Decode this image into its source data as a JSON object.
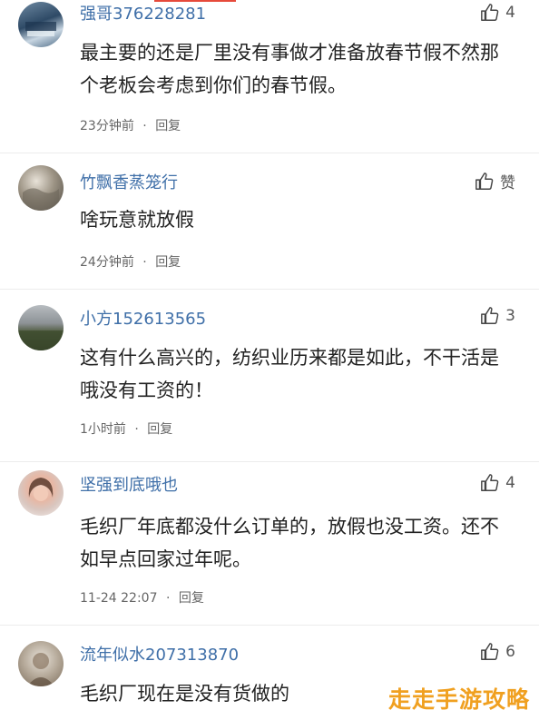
{
  "comments": [
    {
      "username": "强哥376228281",
      "likes": "4",
      "content": "最主要的还是厂里没有事做才准备放春节假不然那个老板会考虑到你们的春节假。",
      "time": "23分钟前",
      "reply": "回复"
    },
    {
      "username": "竹飘香蒸笼行",
      "likes": "赞",
      "content": "啥玩意就放假",
      "time": "24分钟前",
      "reply": "回复"
    },
    {
      "username": "小方152613565",
      "likes": "3",
      "content": "这有什么高兴的，纺织业历来都是如此，不干活是哦没有工资的！",
      "time": "1小时前",
      "reply": "回复"
    },
    {
      "username": "坚强到底哦也",
      "likes": "4",
      "content": "毛织厂年底都没什么订单的，放假也没工资。还不如早点回家过年呢。",
      "time": "11-24 22:07",
      "reply": "回复"
    },
    {
      "username": "流年似水207313870",
      "likes": "6",
      "content": "毛织厂现在是没有货做的",
      "time": "",
      "reply": ""
    }
  ],
  "meta_separator": "·",
  "watermark": "走走手游攻略"
}
